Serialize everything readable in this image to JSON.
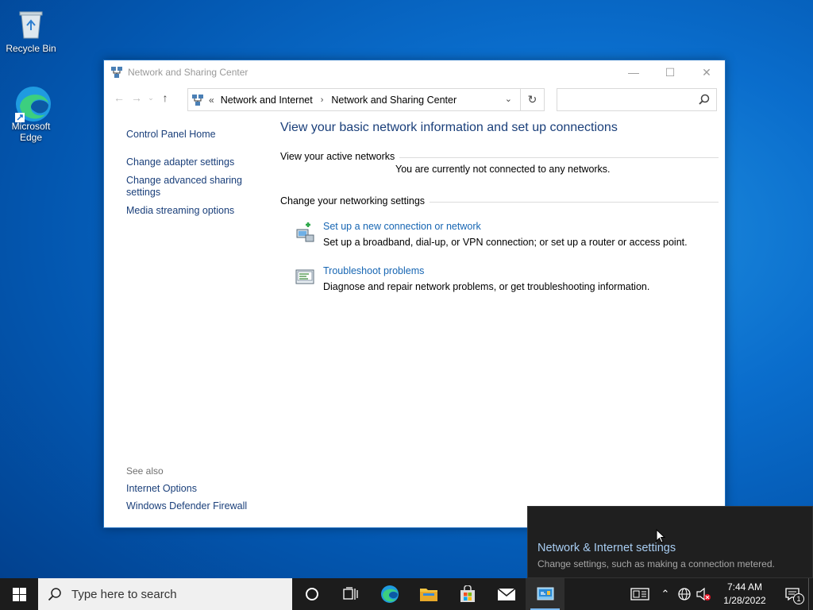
{
  "desktop": {
    "icons": [
      {
        "label": "Recycle Bin"
      },
      {
        "label": "Microsoft Edge"
      }
    ]
  },
  "window": {
    "title": "Network and Sharing Center",
    "breadcrumbs": [
      "Network and Internet",
      "Network and Sharing Center"
    ],
    "search_placeholder": ""
  },
  "left_pane": {
    "links": [
      "Control Panel Home",
      "Change adapter settings",
      "Change advanced sharing settings",
      "Media streaming options"
    ],
    "see_also_header": "See also",
    "see_also": [
      "Internet Options",
      "Windows Defender Firewall"
    ]
  },
  "main": {
    "heading": "View your basic network information and set up connections",
    "active_networks_label": "View your active networks",
    "not_connected": "You are currently not connected to any networks.",
    "change_settings_label": "Change your networking settings",
    "tasks": [
      {
        "title": "Set up a new connection or network",
        "desc": "Set up a broadband, dial-up, or VPN connection; or set up a router or access point.",
        "icon": "network-setup-icon"
      },
      {
        "title": "Troubleshoot problems",
        "desc": "Diagnose and repair network problems, or get troubleshooting information.",
        "icon": "troubleshoot-icon"
      }
    ]
  },
  "toast": {
    "title": "Network & Internet settings",
    "desc": "Change settings, such as making a connection metered."
  },
  "taskbar": {
    "search_placeholder": "Type here to search",
    "time": "7:44 AM",
    "date": "1/28/2022",
    "notification_count": "1"
  }
}
